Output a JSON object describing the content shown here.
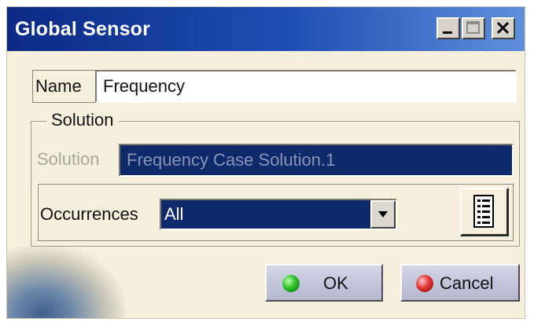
{
  "window": {
    "title": "Global Sensor",
    "minimize_icon": "minimize-icon",
    "maximize_icon": "maximize-icon",
    "close_icon": "close-icon"
  },
  "name": {
    "label": "Name",
    "value": "Frequency"
  },
  "solution_group": {
    "title": "Solution",
    "solution_label": "Solution",
    "solution_value": "Frequency Case Solution.1",
    "occurrences_label": "Occurrences",
    "occurrences_selected": "All",
    "list_icon": "list-icon"
  },
  "buttons": {
    "ok_label": "OK",
    "cancel_label": "Cancel"
  },
  "colors": {
    "title_bar": "#0b2a84",
    "dialog_bg": "#f6efdc",
    "selected_field_bg": "#0e2a6b",
    "ok_dot": "#2fbf2a",
    "cancel_dot": "#e23434"
  }
}
